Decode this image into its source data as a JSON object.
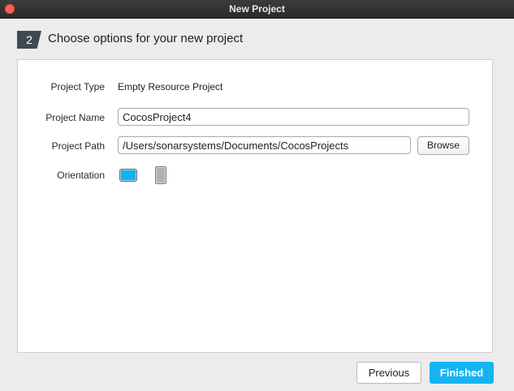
{
  "window": {
    "title": "New Project"
  },
  "step": {
    "number": "2",
    "title": "Choose options for your new project"
  },
  "form": {
    "project_type_label": "Project Type",
    "project_type_value": "Empty Resource Project",
    "project_name_label": "Project Name",
    "project_name_value": "CocosProject4",
    "project_path_label": "Project Path",
    "project_path_value": "/Users/sonarsystems/Documents/CocosProjects",
    "browse_label": "Browse",
    "orientation_label": "Orientation",
    "orientation_selected": "landscape"
  },
  "footer": {
    "previous_label": "Previous",
    "finished_label": "Finished"
  },
  "colors": {
    "accent": "#16b3f2",
    "close_button": "#fc5f57"
  }
}
